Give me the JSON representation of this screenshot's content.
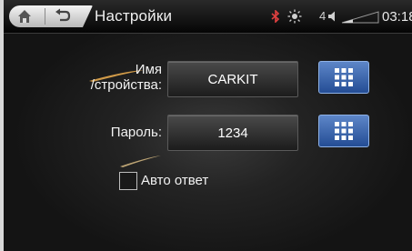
{
  "header": {
    "title": "Настройки",
    "signal_number": "4",
    "clock": "03:18"
  },
  "icons": {
    "home": "home-icon",
    "back": "back-icon",
    "bluetooth": "bluetooth-icon",
    "brightness": "sun-icon",
    "volume": "speaker-icon",
    "signal": "signal-icon",
    "keyboard": "keypad-grid-icon"
  },
  "form": {
    "device_name_label_line1": "Имя",
    "device_name_label_line2": "/стройства:",
    "device_name_value": "CARKIT",
    "password_label": "Пароль:",
    "password_value": "1234",
    "auto_answer_label": "Авто ответ"
  },
  "colors": {
    "accent_button": "#3a66b0",
    "glow": "#e8a040"
  }
}
